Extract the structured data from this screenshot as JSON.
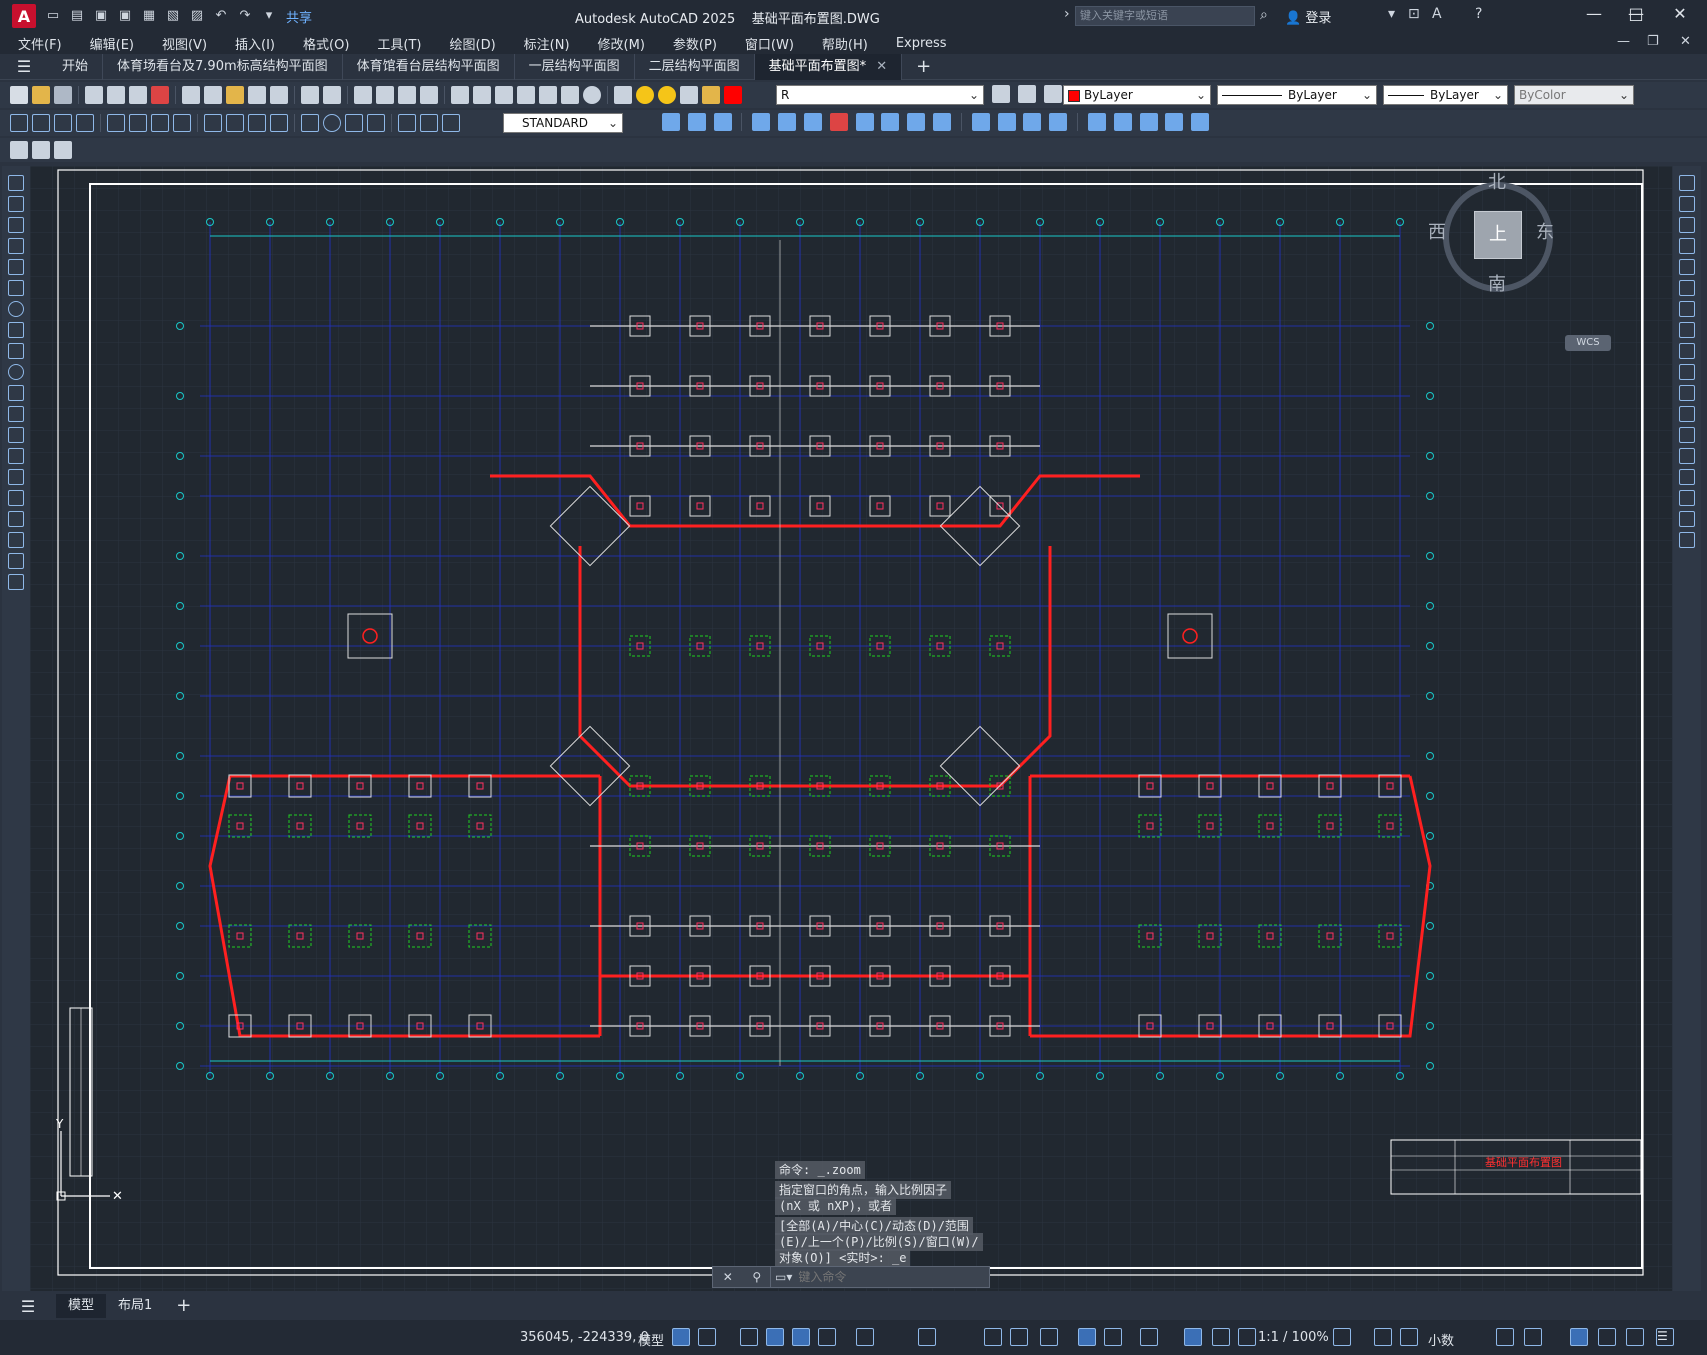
{
  "titlebar": {
    "app_title": "Autodesk AutoCAD 2025",
    "document": "基础平面布置图.DWG",
    "share": "共享",
    "search_placeholder": "键入关键字或短语",
    "login": "登录"
  },
  "menu": [
    "文件(F)",
    "编辑(E)",
    "视图(V)",
    "插入(I)",
    "格式(O)",
    "工具(T)",
    "绘图(D)",
    "标注(N)",
    "修改(M)",
    "参数(P)",
    "窗口(W)",
    "帮助(H)",
    "Express"
  ],
  "file_tabs": [
    {
      "label": "开始",
      "active": false
    },
    {
      "label": "体育场看台及7.90m标高结构平面图",
      "active": false
    },
    {
      "label": "体育馆看台层结构平面图",
      "active": false
    },
    {
      "label": "一层结构平面图",
      "active": false
    },
    {
      "label": "二层结构平面图",
      "active": false
    },
    {
      "label": "基础平面布置图*",
      "active": true
    }
  ],
  "properties": {
    "layer": "R",
    "color": "ByLayer",
    "linetype": "ByLayer",
    "lineweight": "ByLayer",
    "plotstyle": "ByColor",
    "text_style": "STANDARD",
    "layer_color_hex": "#ff0000"
  },
  "viewcube": {
    "north": "北",
    "south": "南",
    "east": "东",
    "west": "西",
    "top": "上",
    "wcs": "WCS"
  },
  "command": {
    "history": [
      "命令: _.zoom",
      "指定窗口的角点，输入比例因子",
      "(nX 或 nXP)，或者",
      "[全部(A)/中心(C)/动态(D)/范围",
      "(E)/上一个(P)/比例(S)/窗口(W)/",
      "对象(O)] <实时>: _e"
    ],
    "placeholder": "键入命令"
  },
  "title_block": {
    "drawing_name": "基础平面布置图"
  },
  "layout_tabs": [
    {
      "label": "模型",
      "active": true
    },
    {
      "label": "布局1",
      "active": false
    }
  ],
  "status": {
    "coords": "356045, -224339, 0",
    "space": "模型",
    "scale": "1:1 / 100%",
    "units": "小数"
  }
}
